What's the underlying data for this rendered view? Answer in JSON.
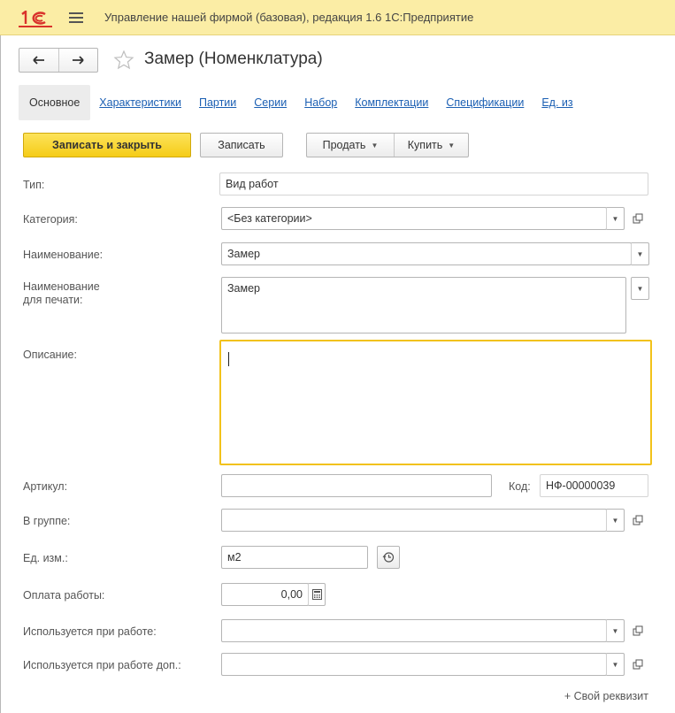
{
  "app": {
    "title": "Управление нашей фирмой (базовая), редакция 1.6 1С:Предприятие",
    "logo_text": "1С"
  },
  "header": {
    "form_title": "Замер (Номенклатура)",
    "back_icon": "arrow-left-icon",
    "forward_icon": "arrow-right-icon",
    "star_icon": "star-icon"
  },
  "tabs": [
    {
      "label": "Основное",
      "active": true
    },
    {
      "label": "Характеристики"
    },
    {
      "label": "Партии"
    },
    {
      "label": "Серии"
    },
    {
      "label": "Набор"
    },
    {
      "label": "Комплектации"
    },
    {
      "label": "Спецификации"
    },
    {
      "label": "Ед. из"
    }
  ],
  "toolbar": {
    "save_close": "Записать и закрыть",
    "save": "Записать",
    "sell": "Продать",
    "buy": "Купить"
  },
  "form": {
    "type": {
      "label": "Тип:",
      "value": "Вид работ"
    },
    "category": {
      "label": "Категория:",
      "value": "<Без категории>"
    },
    "name": {
      "label": "Наименование:",
      "value": "Замер"
    },
    "print_name": {
      "label": "Наименование\nдля печати:",
      "label_line1": "Наименование",
      "label_line2": "для печати:",
      "value": "Замер"
    },
    "description": {
      "label": "Описание:",
      "value": ""
    },
    "article": {
      "label": "Артикул:",
      "value": ""
    },
    "code": {
      "label": "Код:",
      "value": "НФ-00000039"
    },
    "group": {
      "label": "В группе:",
      "value": ""
    },
    "unit": {
      "label": "Ед. изм.:",
      "value": "м2"
    },
    "payment": {
      "label": "Оплата работы:",
      "value": "0,00"
    },
    "used_in_work": {
      "label": "Используется при работе:",
      "value": ""
    },
    "used_in_work_extra": {
      "label": "Используется при работе доп.:",
      "value": ""
    }
  },
  "footer": {
    "add_attribute": "+ Свой реквизит"
  },
  "colors": {
    "titlebar_bg": "#fbeda5",
    "primary_button": "#f5cc17",
    "focus_border": "#f2c21a",
    "link": "#1b5fb3",
    "logo": "#d9322b"
  }
}
